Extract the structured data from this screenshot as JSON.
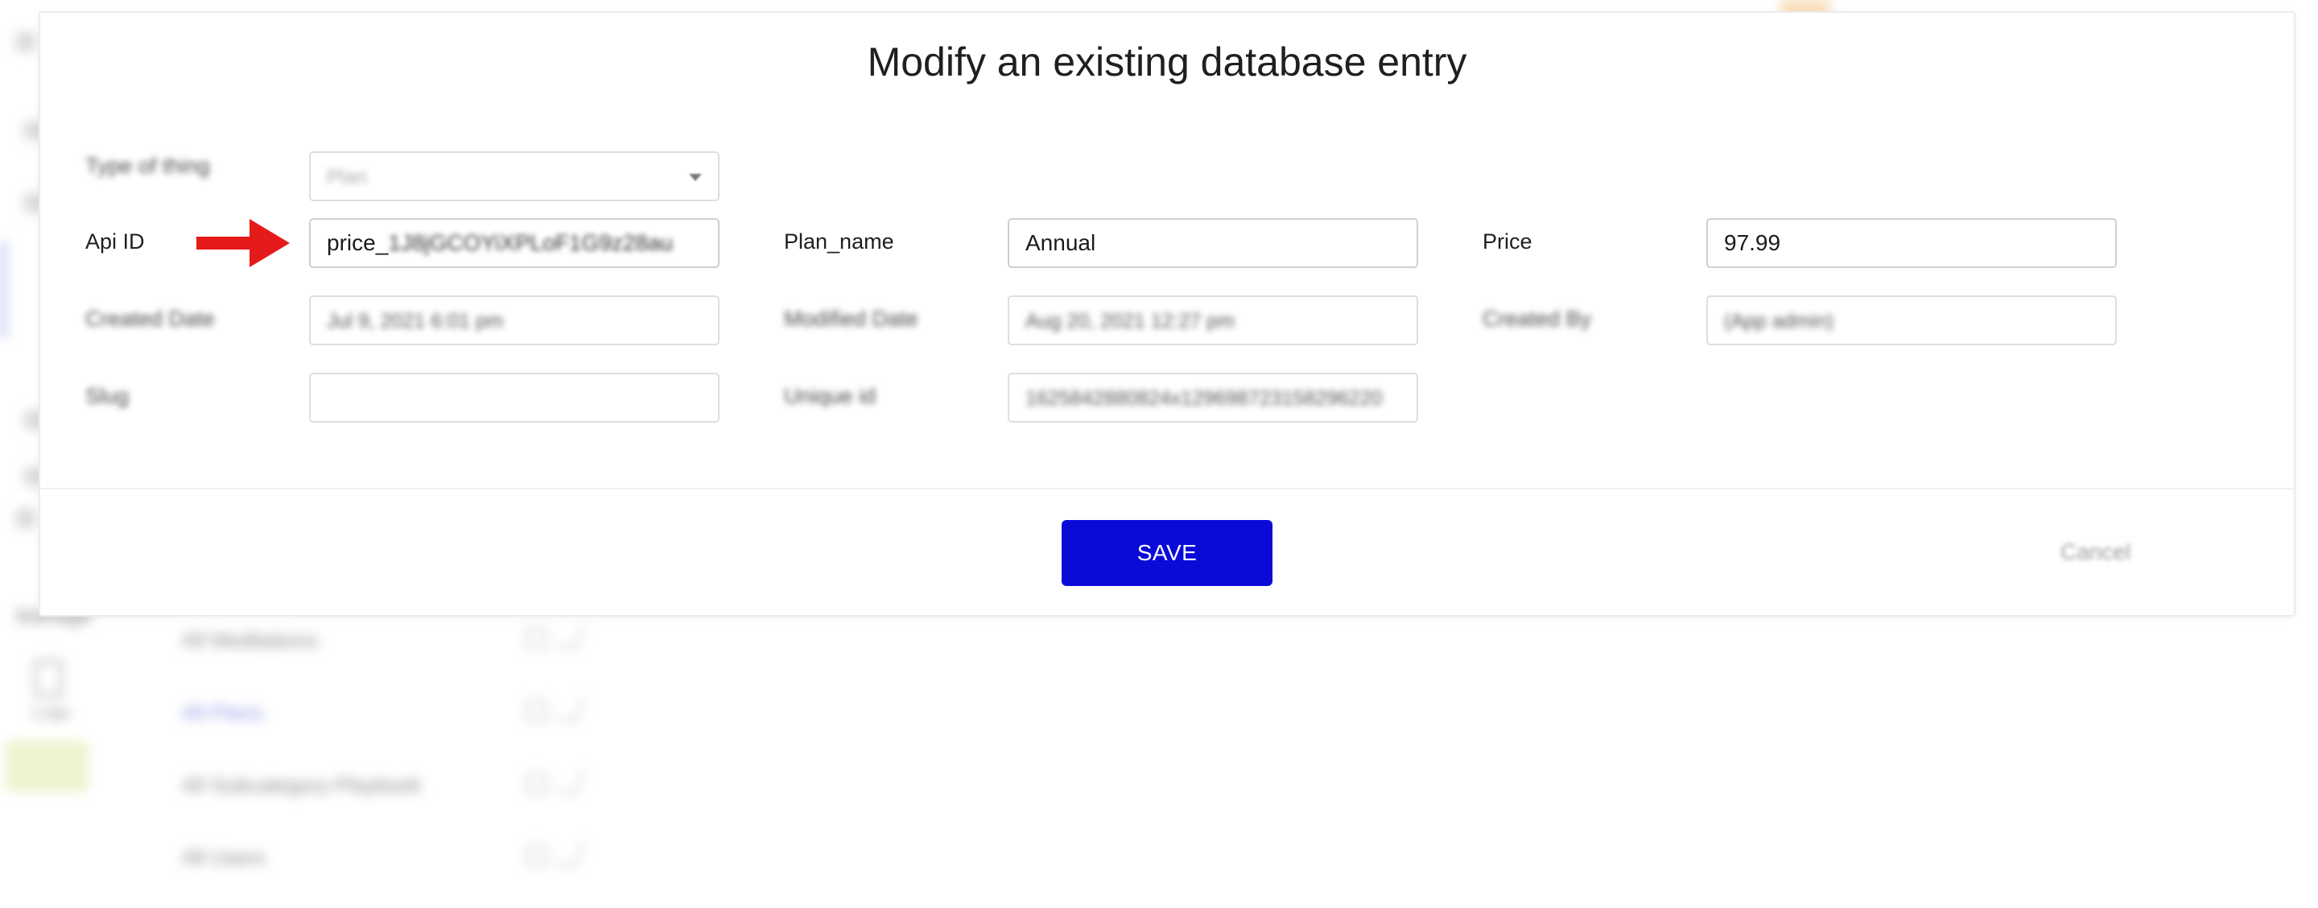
{
  "background": {
    "sidebar_label": "Manage",
    "logs_label": "Logs",
    "types": [
      {
        "label": "All Meditations"
      },
      {
        "label": "All Plans"
      },
      {
        "label": "All Subcategory-Playbook"
      },
      {
        "label": "All Users"
      }
    ]
  },
  "modal": {
    "title": "Modify an existing database entry",
    "type_of_thing": {
      "label": "Type of thing",
      "value": "Plan"
    },
    "fields": {
      "api_id": {
        "label": "Api ID",
        "value_prefix": "price_",
        "value_rest": "1J8jGCOYiXPLoF1G9z28au"
      },
      "plan_name": {
        "label": "Plan_name",
        "value": "Annual"
      },
      "price": {
        "label": "Price",
        "value": "97.99"
      },
      "created_date": {
        "label": "Created Date",
        "value": "Jul 9, 2021 6:01 pm"
      },
      "modified_date": {
        "label": "Modified Date",
        "value": "Aug 20, 2021 12:27 pm"
      },
      "created_by": {
        "label": "Created By",
        "value": "(App admin)"
      },
      "slug": {
        "label": "Slug",
        "value": ""
      },
      "unique_id": {
        "label": "Unique id",
        "value": "1625842880824x129698723158296220"
      }
    },
    "save_label": "SAVE",
    "cancel_label": "Cancel"
  },
  "colors": {
    "save_button": "#0b0bd8",
    "arrow": "#e51a1a"
  },
  "icons": {
    "annotation": "red-arrow-icon",
    "dropdown": "chevron-down-icon"
  }
}
